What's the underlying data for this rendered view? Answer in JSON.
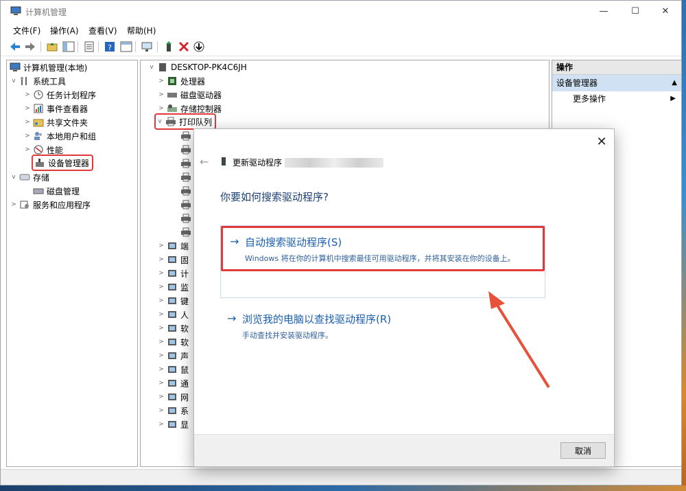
{
  "window": {
    "title": "计算机管理"
  },
  "menu": [
    "文件(F)",
    "操作(A)",
    "查看(V)",
    "帮助(H)"
  ],
  "left_tree": [
    {
      "label": "计算机管理(本地)",
      "depth": 0,
      "caret": ""
    },
    {
      "label": "系统工具",
      "depth": 1,
      "caret": "v"
    },
    {
      "label": "任务计划程序",
      "depth": 2,
      "caret": ">"
    },
    {
      "label": "事件查看器",
      "depth": 2,
      "caret": ">"
    },
    {
      "label": "共享文件夹",
      "depth": 2,
      "caret": ">"
    },
    {
      "label": "本地用户和组",
      "depth": 2,
      "caret": ">"
    },
    {
      "label": "性能",
      "depth": 2,
      "caret": ">"
    },
    {
      "label": "设备管理器",
      "depth": 2,
      "caret": "",
      "highlighted": true
    },
    {
      "label": "存储",
      "depth": 1,
      "caret": "v"
    },
    {
      "label": "磁盘管理",
      "depth": 2,
      "caret": ""
    },
    {
      "label": "服务和应用程序",
      "depth": 1,
      "caret": ">"
    }
  ],
  "device_tree": {
    "root": "DESKTOP-PK4C6JH",
    "items": [
      {
        "label": "处理器",
        "caret": ">"
      },
      {
        "label": "磁盘驱动器",
        "caret": ">"
      },
      {
        "label": "存储控制器",
        "caret": ">"
      },
      {
        "label": "打印队列",
        "caret": "v",
        "highlighted": true
      }
    ],
    "printer_children": [
      "",
      "",
      "",
      "",
      "",
      "",
      "",
      ""
    ],
    "more_items": [
      "端",
      "固",
      "计",
      "监",
      "键",
      "人",
      "软",
      "软",
      "声",
      "鼠",
      "通",
      "网",
      "系",
      "显"
    ]
  },
  "actions_pane": {
    "header": "操作",
    "selected": "设备管理器",
    "item": "更多操作"
  },
  "dialog": {
    "header": "更新驱动程序",
    "question": "你要如何搜索驱动程序?",
    "option1": {
      "title": "自动搜索驱动程序(S)",
      "desc": "Windows 将在你的计算机中搜索最佳可用驱动程序，并将其安装在你的设备上。"
    },
    "option2": {
      "title": "浏览我的电脑以查找驱动程序(R)",
      "desc": "手动查找并安装驱动程序。"
    },
    "cancel": "取消"
  },
  "colors": {
    "highlight": "#e03a3a",
    "link": "#1a5fb4",
    "selected": "#cfe1f3"
  }
}
